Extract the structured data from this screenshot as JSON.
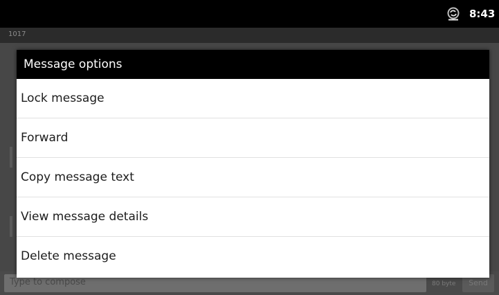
{
  "status_bar": {
    "time": "8:43",
    "icon": "sync-icon"
  },
  "app": {
    "title": "1017"
  },
  "compose": {
    "placeholder": "Type to compose",
    "byte_count": "80 byte",
    "send_label": "Send"
  },
  "dialog": {
    "title": "Message options",
    "items": [
      {
        "label": "Lock message"
      },
      {
        "label": "Forward"
      },
      {
        "label": "Copy message text"
      },
      {
        "label": "View message details"
      },
      {
        "label": "Delete message"
      }
    ]
  },
  "colors": {
    "status_bar_bg": "#000000",
    "dialog_title_bg": "#000000",
    "dialog_bg": "#ffffff",
    "dim_overlay": "#3a3a3a"
  }
}
